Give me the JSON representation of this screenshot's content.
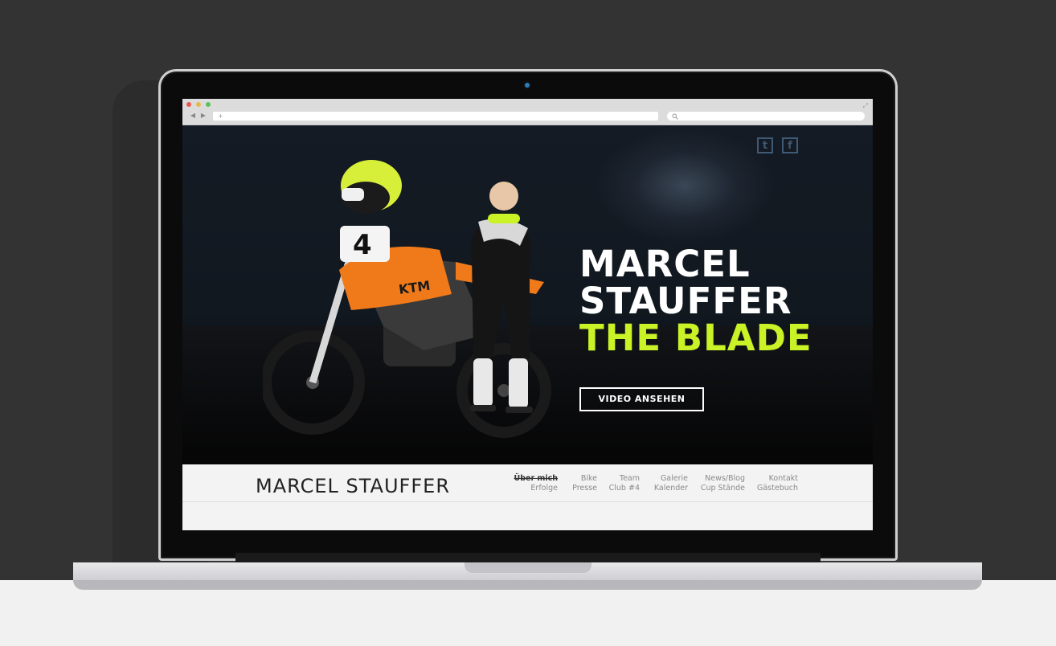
{
  "browser": {
    "url": "",
    "search_placeholder": "",
    "new_tab": "+",
    "back": "◀",
    "forward": "▶"
  },
  "hero": {
    "headline_line1": "MARCEL",
    "headline_line2": "STAUFFER",
    "headline_line3": "THE BLADE",
    "video_button": "VIDEO ANSEHEN",
    "accent_color": "#c9f227",
    "social": {
      "twitter": "t",
      "facebook": "f"
    }
  },
  "site": {
    "brand": "MARCEL STAUFFER",
    "menu": [
      {
        "top": "Über mich",
        "bottom": "Erfolge"
      },
      {
        "top": "Bike",
        "bottom": "Presse"
      },
      {
        "top": "Team",
        "bottom": "Club #4"
      },
      {
        "top": "Galerie",
        "bottom": "Kalender"
      },
      {
        "top": "News/Blog",
        "bottom": "Cup Stände"
      },
      {
        "top": "Kontakt",
        "bottom": "Gästebuch"
      }
    ]
  },
  "bike_number": "4"
}
